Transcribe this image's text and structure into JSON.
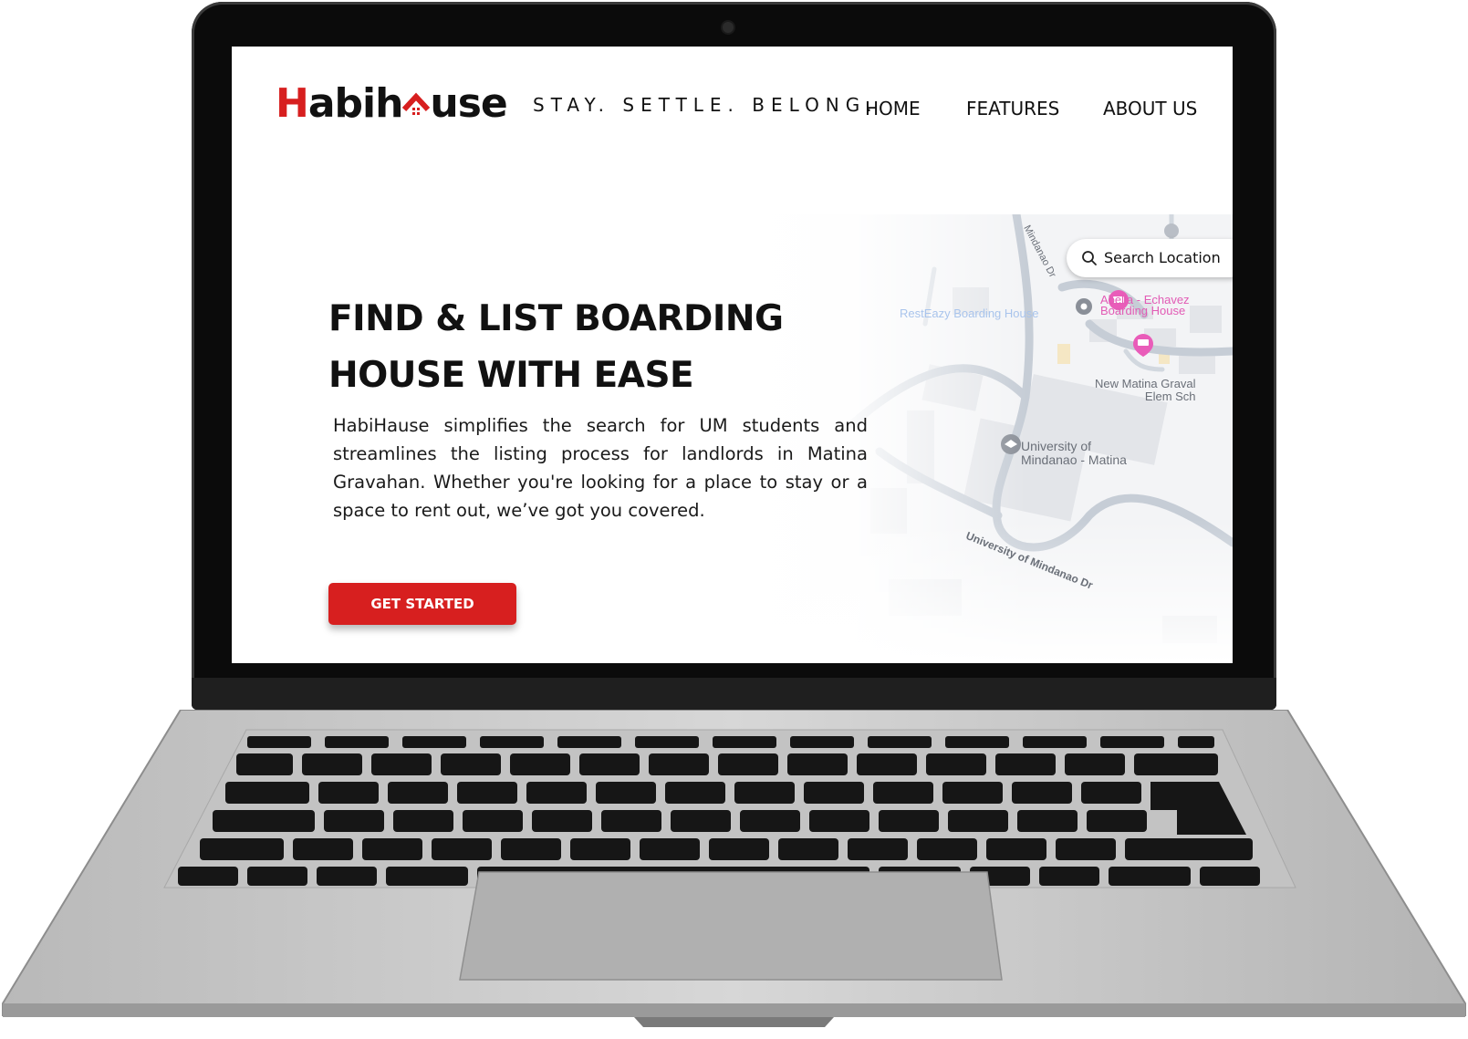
{
  "brand": {
    "logo_first": "H",
    "logo_mid": "abih",
    "logo_last": "use",
    "tagline": "STAY. SETTLE. BELONG.",
    "accent_color": "#d71f1f"
  },
  "nav": {
    "items": [
      {
        "label": "HOME"
      },
      {
        "label": "FEATURES"
      },
      {
        "label": "ABOUT US"
      }
    ]
  },
  "hero": {
    "title_line1": "FIND & LIST BOARDING",
    "title_line2": "HOUSE WITH EASE",
    "description": "HabiHause simplifies the search for UM students and streamlines the listing process for landlords in Matina Gravahan. Whether you're looking for a place to stay or a space to rent out, we’ve got you covered.",
    "cta_label": "GET STARTED"
  },
  "map": {
    "search_placeholder": "Search Location",
    "search_icon": "search-icon",
    "labels": {
      "resteazy": "RestEazy Boarding House",
      "abella_line1": "Abella - Echavez",
      "abella_line2": "Boarding House",
      "newmatina_line1": "New Matina Graval",
      "newmatina_line2": "Elem Sch",
      "um_line1": "University of",
      "um_line2": "Mindanao - Matina",
      "road_um": "University of Mindanao Dr",
      "road_top": "Mindanao Dr"
    },
    "pin_colors": {
      "boarding": "#e95cb9",
      "place": "#8a8f98",
      "school": "#8a8f98"
    }
  }
}
